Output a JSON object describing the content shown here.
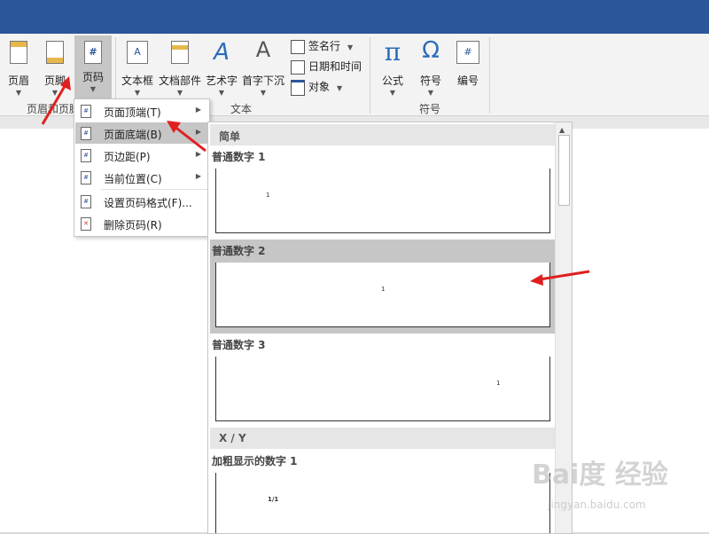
{
  "ribbon": {
    "buttons": {
      "header": "页眉",
      "footer": "页脚",
      "page_number": "页码",
      "textbox": "文本框",
      "doc_parts": "文档部件",
      "wordart": "艺术字",
      "dropcap": "首字下沉",
      "signature": "签名行",
      "datetime": "日期和时间",
      "object": "对象",
      "formula": "公式",
      "symbol": "符号",
      "numbering": "编号"
    },
    "groups": {
      "header_footer": "页眉和页脚",
      "text": "文本",
      "symbols": "符号"
    }
  },
  "context_menu": {
    "items": [
      {
        "label": "页面顶端(T)",
        "submenu": true
      },
      {
        "label": "页面底端(B)",
        "submenu": true
      },
      {
        "label": "页边距(P)",
        "submenu": true
      },
      {
        "label": "当前位置(C)",
        "submenu": true
      },
      {
        "label": "设置页码格式(F)...",
        "submenu": false
      },
      {
        "label": "删除页码(R)",
        "submenu": false
      }
    ]
  },
  "gallery": {
    "section_simple": "简单",
    "section_xy": "X / Y",
    "items": [
      {
        "title": "普通数字 1",
        "preview_text": "1"
      },
      {
        "title": "普通数字 2",
        "preview_text": "1"
      },
      {
        "title": "普通数字 3",
        "preview_text": "1"
      },
      {
        "title": "加粗显示的数字 1",
        "preview_text": "1/1"
      }
    ]
  },
  "watermark": {
    "main": "Bai度 经验",
    "url": "jingyan.baidu.com"
  }
}
